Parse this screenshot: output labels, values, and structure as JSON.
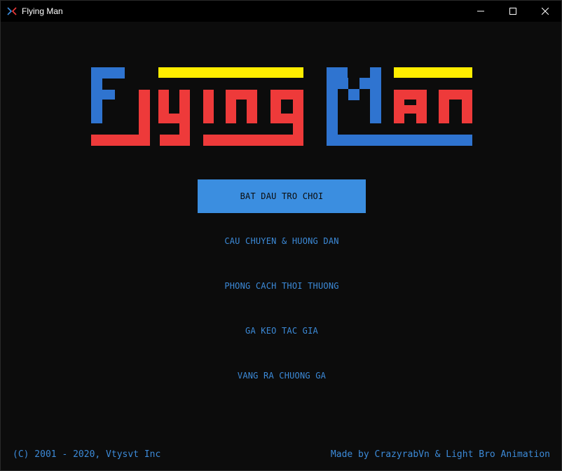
{
  "window": {
    "title": "Flying Man",
    "icons": {
      "app": "crossed-arrows-icon",
      "minimize": "minimize-icon",
      "maximize": "maximize-icon",
      "close": "close-icon"
    }
  },
  "logo": {
    "text": "Flying Man",
    "colors": {
      "blue": "#2f74d0",
      "red": "#ee3a3a",
      "yellow": "#ffee00"
    }
  },
  "menu": {
    "items": [
      {
        "label": "BAT DAU TRO CHOI",
        "selected": true
      },
      {
        "label": "CAU CHUYEN & HUONG DAN",
        "selected": false
      },
      {
        "label": "PHONG CACH THOI THUONG",
        "selected": false
      },
      {
        "label": "GA KEO TAC GIA",
        "selected": false
      },
      {
        "label": "VANG RA CHUONG GA",
        "selected": false
      }
    ]
  },
  "footer": {
    "copyright": "(C) 2001 - 2020, Vtysvt Inc",
    "credits": "Made by CrazyrabVn & Light Bro Animation"
  },
  "colors": {
    "background": "#0c0c0c",
    "accent": "#3b8ee0",
    "menu_text": "#3c8ad8"
  }
}
